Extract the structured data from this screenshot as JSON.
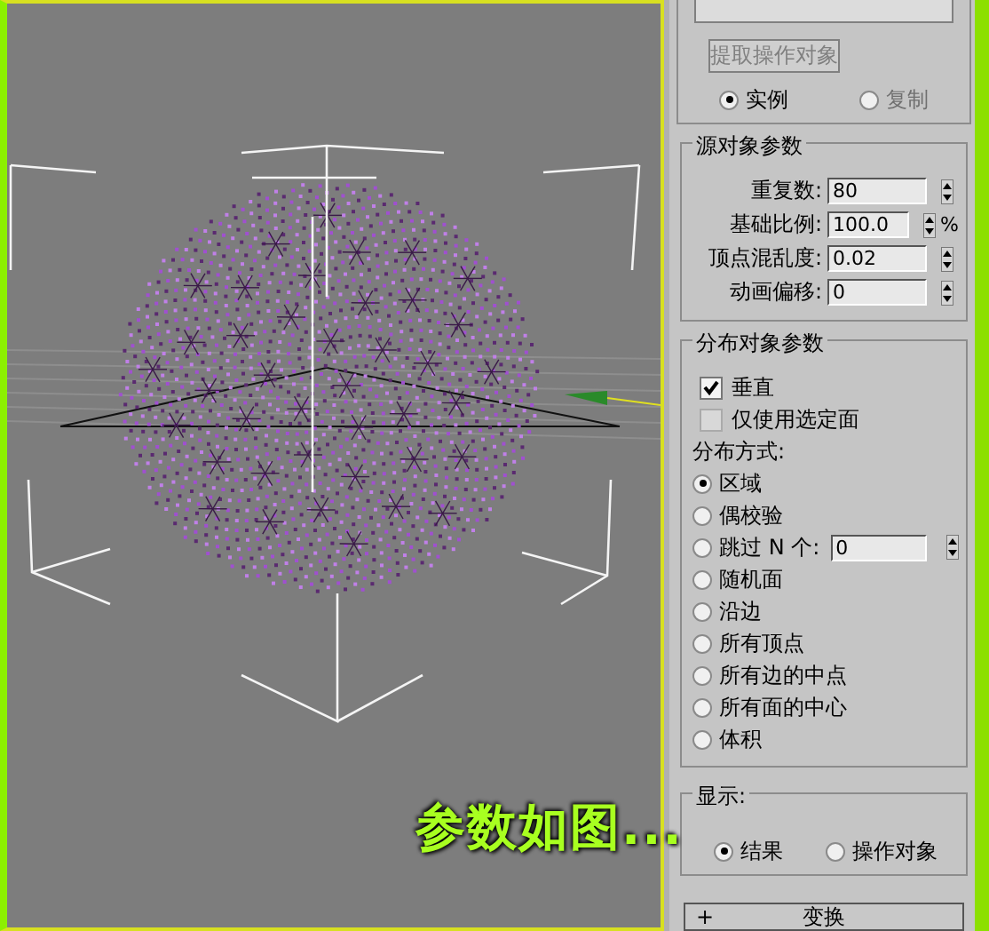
{
  "viewport": {
    "caption": "参数如图..."
  },
  "panel": {
    "pick_button": "提取操作对象",
    "pick_mode": [
      {
        "label": "实例",
        "selected": true
      },
      {
        "label": "复制",
        "selected": false
      }
    ],
    "source_params": {
      "title": "源对象参数",
      "fields": [
        {
          "label": "重复数:",
          "value": "80"
        },
        {
          "label": "基础比例:",
          "value": "100.0",
          "unit": "%"
        },
        {
          "label": "顶点混乱度:",
          "value": "0.02"
        },
        {
          "label": "动画偏移:",
          "value": "0"
        }
      ]
    },
    "distribution_params": {
      "title": "分布对象参数",
      "checkboxes": [
        {
          "label": "垂直",
          "checked": true
        },
        {
          "label": "仅使用选定面",
          "checked": false
        }
      ],
      "method_label": "分布方式:",
      "methods": [
        {
          "label": "区域",
          "selected": true
        },
        {
          "label": "偶校验",
          "selected": false
        },
        {
          "label": "跳过 N 个:",
          "selected": false,
          "value": "0"
        },
        {
          "label": "随机面",
          "selected": false
        },
        {
          "label": "沿边",
          "selected": false
        },
        {
          "label": "所有顶点",
          "selected": false
        },
        {
          "label": "所有边的中点",
          "selected": false
        },
        {
          "label": "所有面的中心",
          "selected": false
        },
        {
          "label": "体积",
          "selected": false
        }
      ]
    },
    "display": {
      "title": "显示:",
      "options": [
        {
          "label": "结果",
          "selected": true
        },
        {
          "label": "操作对象",
          "selected": false
        }
      ]
    },
    "rollouts": [
      {
        "sign": "+",
        "label": "变换"
      }
    ]
  }
}
